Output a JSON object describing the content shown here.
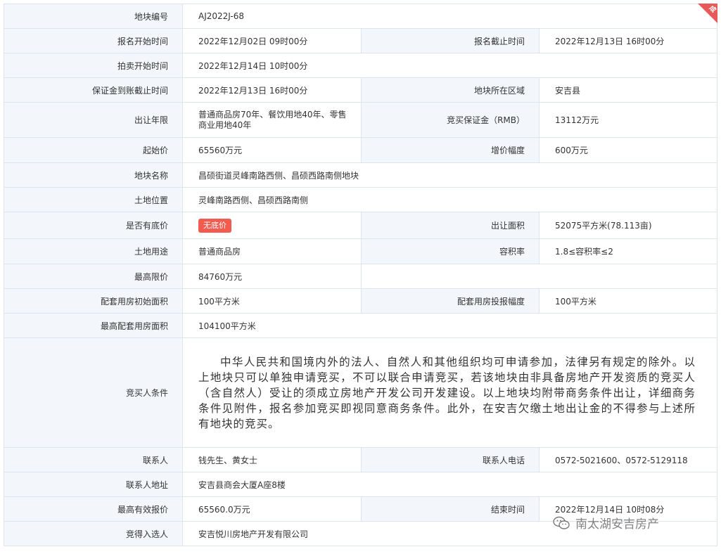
{
  "corner_badge": "成",
  "rows": {
    "parcel_no": {
      "label": "地块编号",
      "value": "AJ2022J-68"
    },
    "reg_start": {
      "label": "报名开始时间",
      "value": "2022年12月02日 09时00分"
    },
    "reg_end": {
      "label": "报名截止时间",
      "value": "2022年12月13日 16时00分"
    },
    "auction_start": {
      "label": "拍卖开始时间",
      "value": "2022年12月14日 10时00分"
    },
    "deposit_deadline": {
      "label": "保证金到账截止时间",
      "value": "2022年12月13日 16时00分"
    },
    "region": {
      "label": "地块所在区域",
      "value": "安吉县"
    },
    "term": {
      "label": "出让年限",
      "value": "普通商品房70年、餐饮用地40年、零售商业用地40年"
    },
    "deposit": {
      "label": "竞买保证金（RMB）",
      "value": "13112万元"
    },
    "start_price": {
      "label": "起始价",
      "value": "65560万元"
    },
    "increment": {
      "label": "增价幅度",
      "value": "600万元"
    },
    "parcel_name": {
      "label": "地块名称",
      "value": "昌硕街道灵峰南路西侧、昌硕西路南侧地块"
    },
    "location": {
      "label": "土地位置",
      "value": "灵峰南路西侧、昌硕西路南侧"
    },
    "reserve": {
      "label": "是否有底价",
      "value": "无底价"
    },
    "area": {
      "label": "出让面积",
      "value": "52075平方米(78.113亩)"
    },
    "usage": {
      "label": "土地用途",
      "value": "普通商品房"
    },
    "far": {
      "label": "容积率",
      "value": "1.8≤容积率≤2"
    },
    "price_cap": {
      "label": "最高限价",
      "value": "84760万元"
    },
    "housing_init": {
      "label": "配套用房初始面积",
      "value": "100平方米"
    },
    "housing_step": {
      "label": "配套用房投报幅度",
      "value": "100平方米"
    },
    "housing_max": {
      "label": "最高配套用房面积",
      "value": "104100平方米"
    },
    "conditions": {
      "label": "竞买人条件",
      "value": "中华人民共和国境内外的法人、自然人和其他组织均可申请参加，法律另有规定的除外。以上地块只可以单独申请竞买，不可以联合申请竞买，若该地块由非具备房地产开发资质的竞买人（含自然人）受让的须成立房地产开发公司开发建设。以上地块均附带商务条件出让，详细商务条件见附件，报名参加竞买即视同意商务条件。此外，在安吉欠缴土地出让金的不得参与上述所有地块的竞买。"
    },
    "contact": {
      "label": "联系人",
      "value": "钱先生、黄女士"
    },
    "phone": {
      "label": "联系人电话",
      "value": "0572-5021600、0572-5129118"
    },
    "address": {
      "label": "联系人地址",
      "value": "安吉县商会大厦A座8楼"
    },
    "highest_bid": {
      "label": "最高有效报价",
      "value": "65560.0万元"
    },
    "end_time": {
      "label": "结束时间",
      "value": "2022年12月14日 10时08分"
    },
    "winner": {
      "label": "竞得入选人",
      "value": "安吉悦川房地产开发有限公司"
    }
  },
  "watermark": {
    "text": "南太湖安吉房产",
    "icon": "wechat-icon"
  },
  "colors": {
    "label_bg": "#f3f6fa",
    "border": "#dde4ec",
    "badge": "#f15b50"
  }
}
